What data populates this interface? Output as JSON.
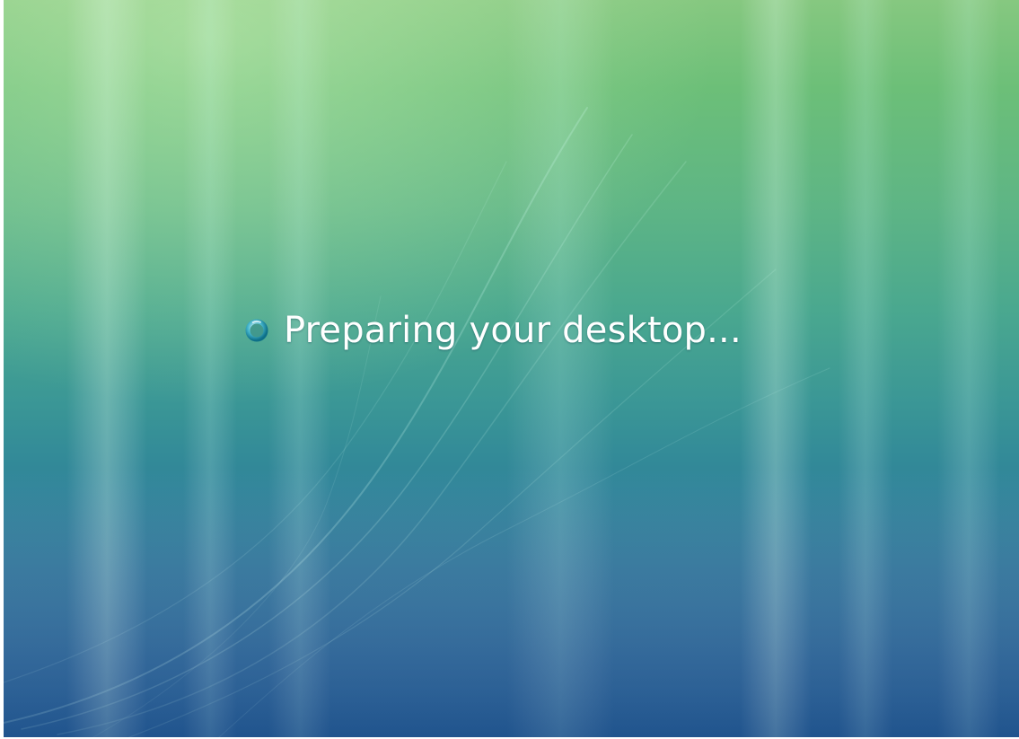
{
  "status": {
    "message": "Preparing your desktop...",
    "icon": "busy-spinner-icon"
  },
  "colors": {
    "background_top": "#86c880",
    "background_middle": "#3a9696",
    "background_bottom": "#22568f",
    "text": "#ffffff",
    "spinner_ring": "#1b8ea8"
  }
}
